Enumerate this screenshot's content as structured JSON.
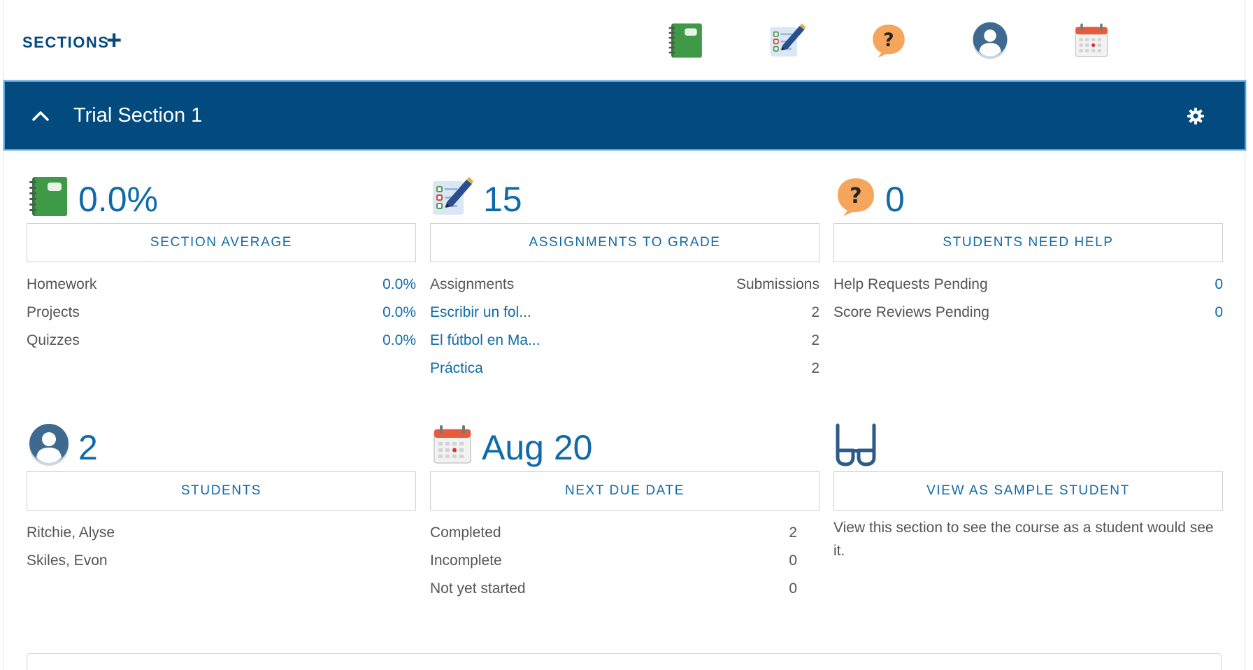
{
  "topbar": {
    "sections_label": "SECTIONS",
    "add_symbol": "+",
    "icons": [
      "gradebook-icon",
      "assignments-icon",
      "help-icon",
      "students-icon",
      "calendar-icon"
    ]
  },
  "section": {
    "title": "Trial Section 1",
    "header_color": "#034a7f"
  },
  "panels": {
    "average": {
      "value": "0.0%",
      "button": "SECTION AVERAGE",
      "rows": [
        {
          "label": "Homework",
          "value": "0.0%"
        },
        {
          "label": "Projects",
          "value": "0.0%"
        },
        {
          "label": "Quizzes",
          "value": "0.0%"
        }
      ]
    },
    "assignments": {
      "value": "15",
      "button": "ASSIGNMENTS TO GRADE",
      "header_left": "Assignments",
      "header_right": "Submissions",
      "rows": [
        {
          "label": "Escribir un fol...",
          "value": "2"
        },
        {
          "label": "El fútbol en Ma...",
          "value": "2"
        },
        {
          "label": "Práctica",
          "value": "2"
        }
      ]
    },
    "help": {
      "value": "0",
      "button": "STUDENTS NEED HELP",
      "rows": [
        {
          "label": "Help Requests Pending",
          "value": "0"
        },
        {
          "label": "Score Reviews Pending",
          "value": "0"
        }
      ]
    },
    "students": {
      "value": "2",
      "button": "STUDENTS",
      "names": [
        "Ritchie, Alyse",
        "Skiles, Evon"
      ]
    },
    "due": {
      "value": "Aug 20",
      "button": "NEXT DUE DATE",
      "rows": [
        {
          "label": "Completed",
          "value": "2"
        },
        {
          "label": "Incomplete",
          "value": "0"
        },
        {
          "label": "Not yet started",
          "value": "0"
        }
      ]
    },
    "sample": {
      "button": "VIEW AS SAMPLE STUDENT",
      "description": "View this section to see the course as a student would see it."
    }
  },
  "colors": {
    "accent": "#0f6aa9",
    "brand": "#034a7f"
  }
}
